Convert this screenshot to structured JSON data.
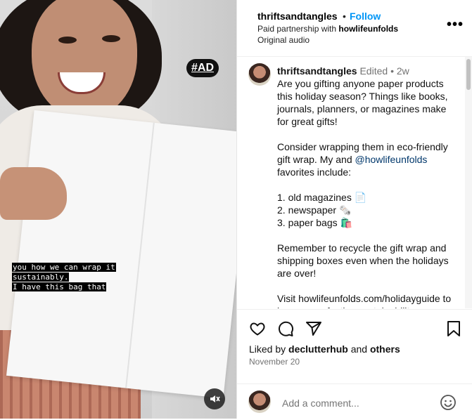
{
  "video": {
    "ad_badge": "#AD",
    "caption_lines": [
      "you how we can wrap it",
      "sustainably.",
      "I have this bag that"
    ],
    "mute_icon": "speaker-muted-icon"
  },
  "header": {
    "username": "thriftsandtangles",
    "separator": "•",
    "follow_label": "Follow",
    "partnership_prefix": "Paid partnership with ",
    "partner": "howlifeunfolds",
    "audio": "Original audio",
    "more_label": "•••"
  },
  "caption": {
    "username": "thriftsandtangles",
    "edited": "Edited",
    "separator": "•",
    "age": "2w",
    "p1": "Are you gifting anyone paper products this holiday season? Things like books, journals, planners, or magazines make for great gifts!",
    "p2_a": "Consider wrapping them in eco-friendly gift wrap. My and ",
    "p2_mention": "@howlifeunfolds",
    "p2_b": " favorites include:",
    "list": [
      "1. old magazines 📄",
      "2. newspaper 🗞️",
      "3. paper bags 🛍️"
    ],
    "p3": "Remember to recycle the gift wrap and shipping boxes even when the holidays are over!",
    "p4": "Visit howlifeunfolds.com/holidayguide to learn more festive sustainability"
  },
  "footer": {
    "liked_prefix": "Liked by ",
    "liked_user": "declutterhub",
    "liked_mid": " and ",
    "liked_others": "others",
    "date": "November 20",
    "comment_placeholder": "Add a comment..."
  },
  "colors": {
    "accent": "#0095f6",
    "mention": "#00376b",
    "muted": "#737373"
  }
}
